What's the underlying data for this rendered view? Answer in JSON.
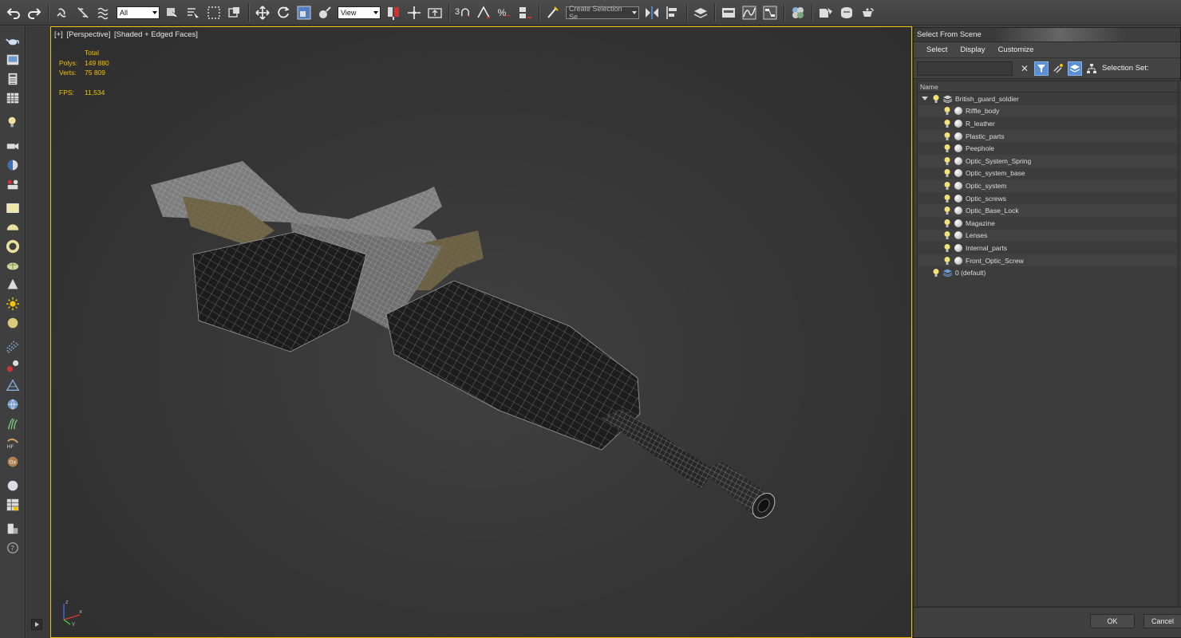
{
  "toolbar": {
    "selection_filter": "All",
    "ref_coord_system": "View",
    "named_selection_placeholder": "Create Selection Se",
    "snap_angle_label": "3",
    "percent_snap_label": "%",
    "colors": {
      "background": "#444444",
      "icon": "#e6e6e6",
      "accent_blue": "#5a8fd6"
    }
  },
  "viewport": {
    "label_parts": [
      "[+]",
      "[Perspective]",
      "[Shaded + Edged Faces]"
    ],
    "stats": {
      "header": "Total",
      "polys_label": "Polys:",
      "polys_value": "149 880",
      "verts_label": "Verts:",
      "verts_value": "75 809",
      "fps_label": "FPS:",
      "fps_value": "11,534"
    },
    "active_border_color": "#f0c000",
    "axis_labels": [
      "z",
      "x",
      "y"
    ]
  },
  "dialog": {
    "title": "Select From Scene",
    "menus": [
      "Select",
      "Display",
      "Customize"
    ],
    "search_value": "",
    "selection_set_label": "Selection Set:",
    "column_header": "Name",
    "tree": [
      {
        "name": "British_guard_soldier",
        "level": 0,
        "kind": "layer",
        "expanded": true
      },
      {
        "name": "Riffle_body",
        "level": 1,
        "kind": "object"
      },
      {
        "name": "R_leather",
        "level": 1,
        "kind": "object"
      },
      {
        "name": "Plastic_parts",
        "level": 1,
        "kind": "object"
      },
      {
        "name": "Peephole",
        "level": 1,
        "kind": "object"
      },
      {
        "name": "Optic_System_Spring",
        "level": 1,
        "kind": "object"
      },
      {
        "name": "Optic_system_base",
        "level": 1,
        "kind": "object"
      },
      {
        "name": "Optic_system",
        "level": 1,
        "kind": "object"
      },
      {
        "name": "Optic_screws",
        "level": 1,
        "kind": "object"
      },
      {
        "name": "Optic_Base_Lock",
        "level": 1,
        "kind": "object"
      },
      {
        "name": "Magazine",
        "level": 1,
        "kind": "object"
      },
      {
        "name": "Lenses",
        "level": 1,
        "kind": "object"
      },
      {
        "name": "Internal_parts",
        "level": 1,
        "kind": "object"
      },
      {
        "name": "Front_Optic_Screw",
        "level": 1,
        "kind": "object"
      },
      {
        "name": "0 (default)",
        "level": 0,
        "kind": "layer",
        "expanded": false
      }
    ],
    "ok_label": "OK",
    "cancel_label": "Cancel"
  }
}
